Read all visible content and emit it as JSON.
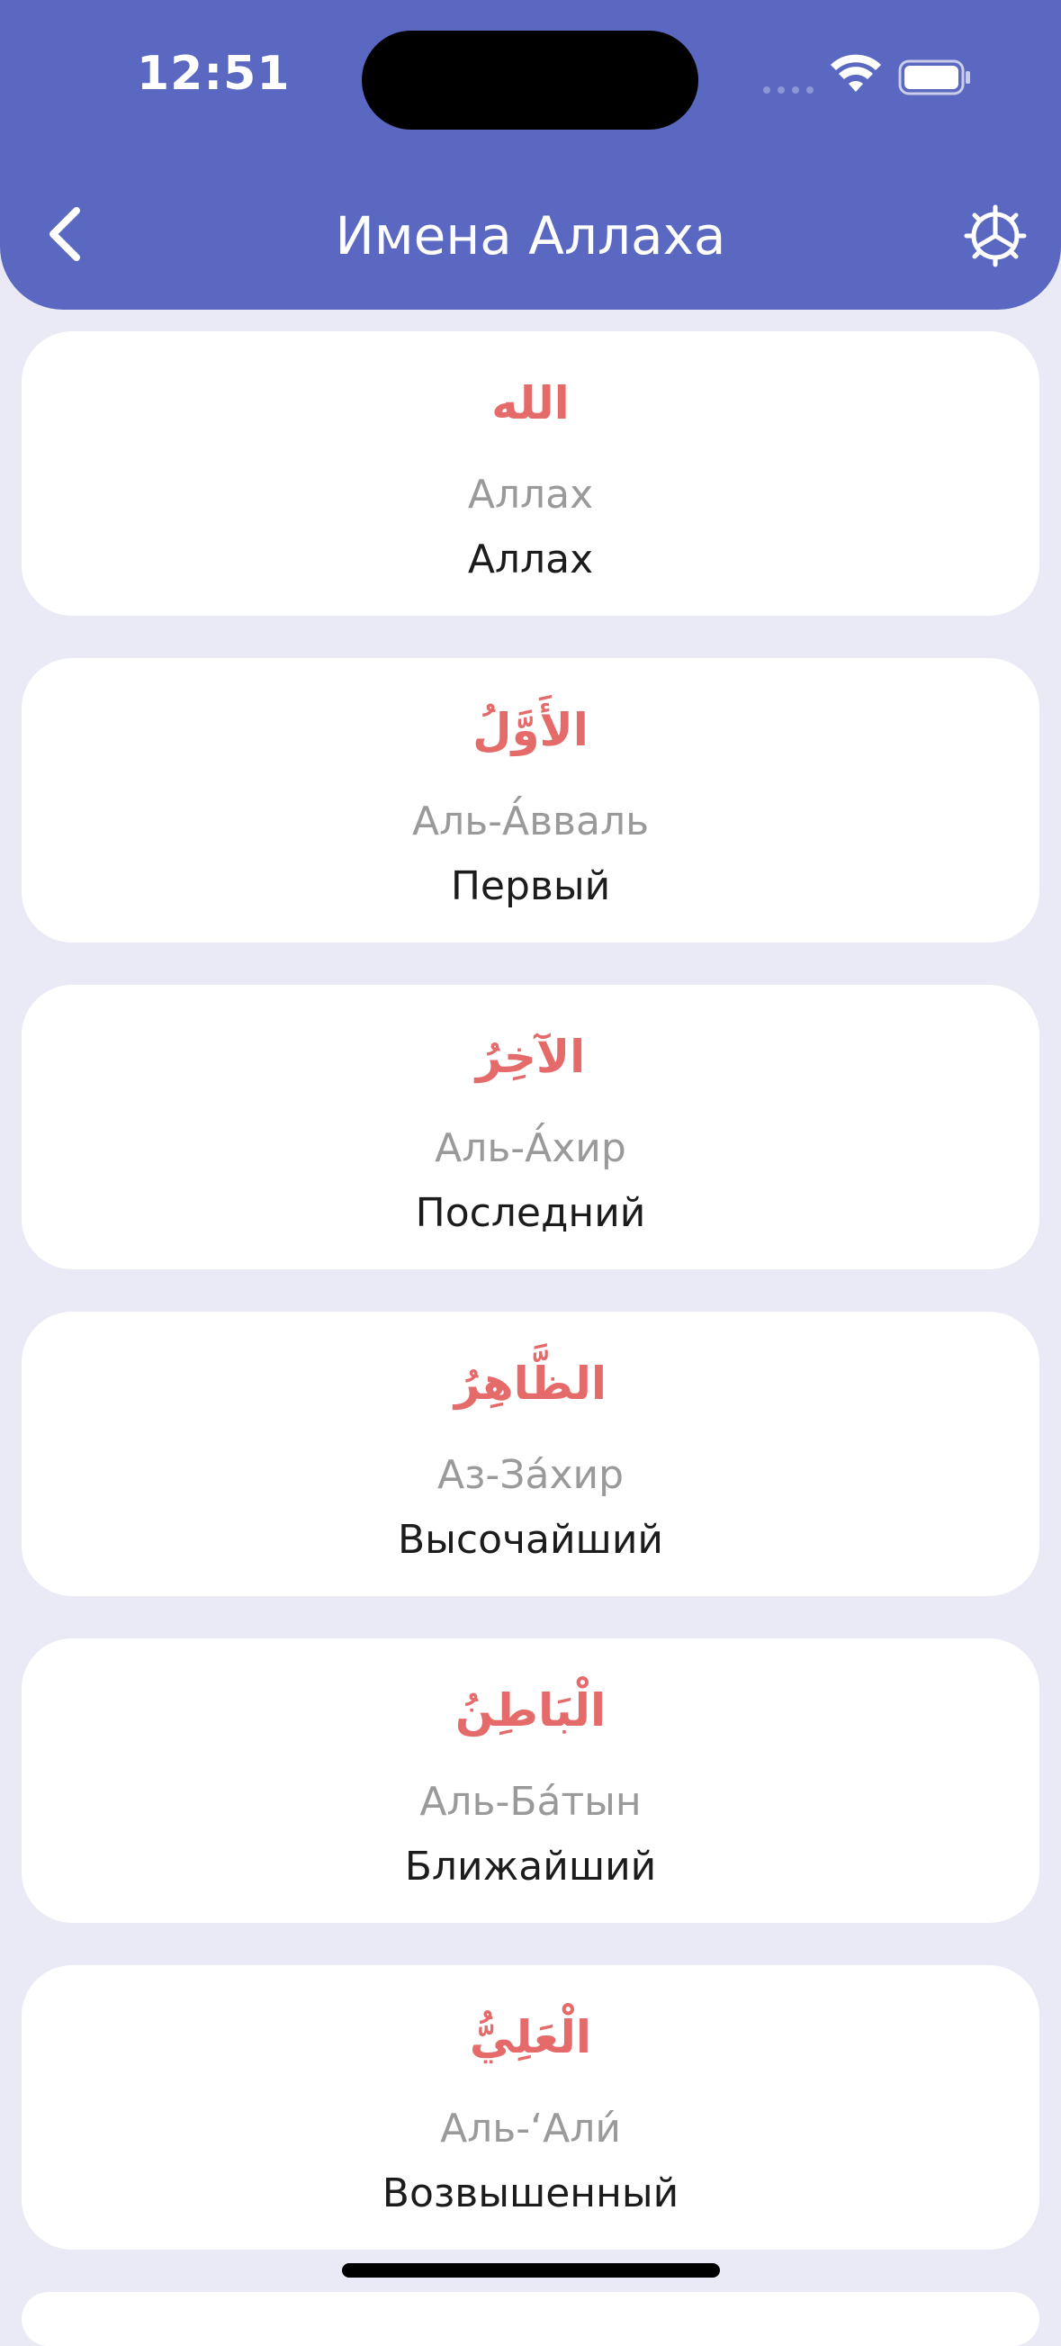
{
  "status_bar": {
    "time": "12:51"
  },
  "header": {
    "title": "Имена Аллаха",
    "back_icon": "chevron-left-icon",
    "settings_icon": "gear-icon",
    "background_color": "#5a68c1"
  },
  "colors": {
    "arabic_text": "#e56a6a",
    "transliteration_text": "#9a9a9a",
    "meaning_text": "#1c1c1c",
    "page_background": "#e9eaf5"
  },
  "names": [
    {
      "arabic": "الله",
      "transliteration": "Аллах",
      "meaning": "Аллах"
    },
    {
      "arabic": "الأَوَّلُ",
      "transliteration": "Аль-А́вваль",
      "meaning": "Первый"
    },
    {
      "arabic": "الآخِرُ",
      "transliteration": "Аль-А́хир",
      "meaning": "Последний"
    },
    {
      "arabic": "الظَّاهِرُ",
      "transliteration": "Аз-За́хир",
      "meaning": "Высочайший"
    },
    {
      "arabic": "الْبَاطِنُ",
      "transliteration": "Аль-Ба́тын",
      "meaning": "Ближайший"
    },
    {
      "arabic": "الْعَلِيُّ",
      "transliteration": "Аль-‘Али́",
      "meaning": "Возвышенный"
    }
  ]
}
